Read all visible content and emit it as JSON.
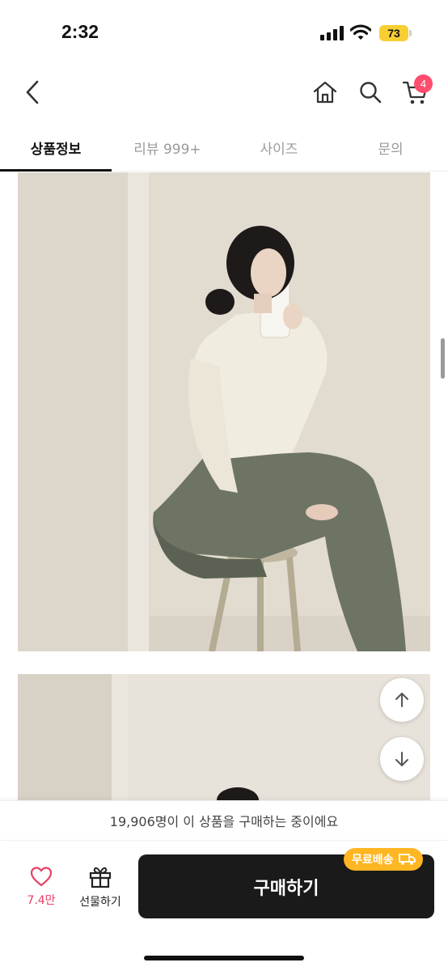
{
  "status_bar": {
    "time": "2:32",
    "battery": "73"
  },
  "nav": {
    "cart_count": "4"
  },
  "tabs": [
    {
      "label": "상품정보",
      "active": true
    },
    {
      "label": "리뷰 999+",
      "active": false
    },
    {
      "label": "사이즈",
      "active": false
    },
    {
      "label": "문의",
      "active": false
    }
  ],
  "notice": {
    "text": "19,906명이 이 상품을 구매하는 중이에요"
  },
  "bottom_bar": {
    "like_count": "7.4만",
    "gift_label": "선물하기",
    "buy_label": "구매하기",
    "shipping_badge": "무료배송"
  },
  "colors": {
    "accent_pink": "#e94167",
    "badge_pink": "#ff4d6d",
    "shipping_yellow": "#ffb623",
    "battery_yellow": "#f7cf33",
    "buy_button": "#1a1a1a"
  },
  "icons": [
    "back-icon",
    "home-icon",
    "search-icon",
    "cart-icon",
    "heart-icon",
    "gift-icon",
    "truck-icon",
    "arrow-up-icon",
    "arrow-down-icon"
  ]
}
